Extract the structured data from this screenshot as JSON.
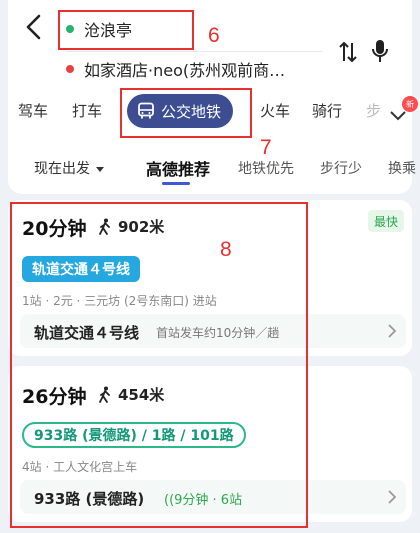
{
  "header": {
    "origin": "沧浪亭",
    "destination": "如家酒店·neo(苏州观前商…",
    "icons": [
      "back-icon",
      "swap-icon",
      "mic-icon"
    ]
  },
  "modes": {
    "items": [
      "驾车",
      "打车",
      "公交地铁",
      "火车",
      "骑行",
      "步"
    ],
    "active": "公交地铁",
    "badge": "新"
  },
  "sort": {
    "depart": "现在出发",
    "options": [
      "高德推荐",
      "地铁优先",
      "步行少",
      "换乘"
    ],
    "active": "高德推荐"
  },
  "annotations": {
    "six": "6",
    "seven": "7",
    "eight": "8"
  },
  "routes": [
    {
      "time": "20分钟",
      "walk": "902米",
      "badge": "最快",
      "line": "轨道交通４号线",
      "meta": "1站 · 2元 · 三元坊 (2号东南口) 进站",
      "detail_line": "轨道交通４号线",
      "detail_note": "首站发车约10分钟／趟"
    },
    {
      "time": "26分钟",
      "walk": "454米",
      "line": "933路 (景德路) / 1路 / 101路",
      "meta": "4站 · 工人文化宫上车",
      "detail_line": "933路 (景德路)",
      "detail_rt": "((9分钟 · 6站"
    }
  ],
  "colors": {
    "annotation": "#e8302f",
    "active_tab": "#3c4e91",
    "metro_chip": "#25a7e0",
    "bus_chip": "#2cb98a",
    "fast_badge": "#2ca34f"
  }
}
